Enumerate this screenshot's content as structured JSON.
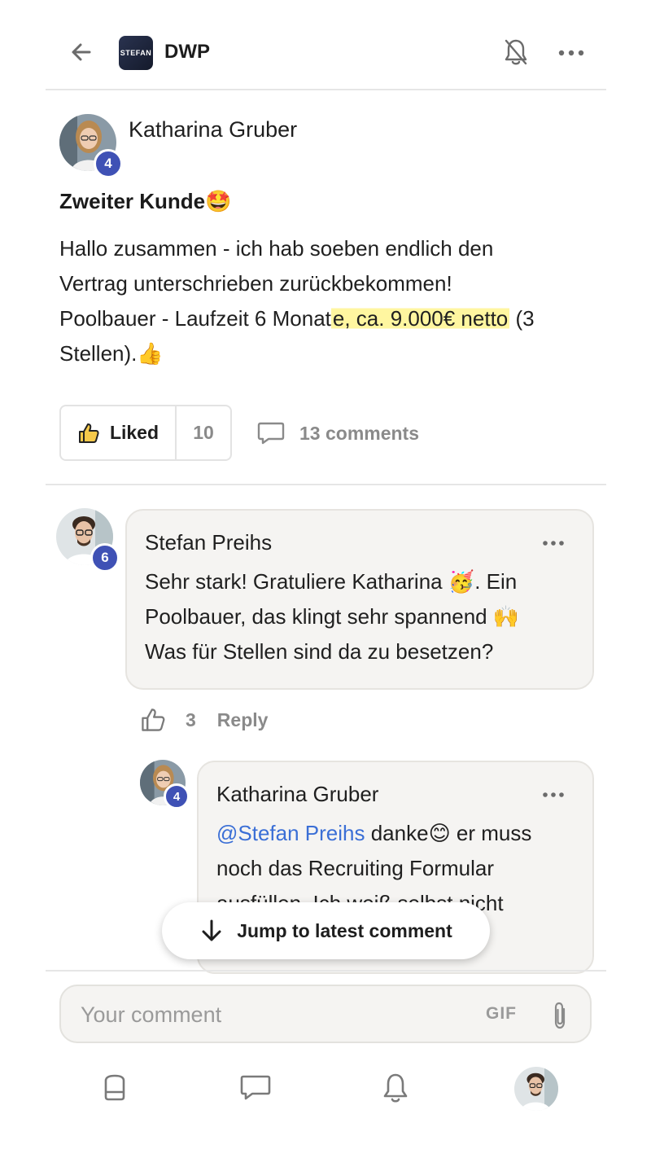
{
  "header": {
    "title": "DWP",
    "logo_text": "STEFAN"
  },
  "post": {
    "author": "Katharina Gruber",
    "author_badge": "4",
    "title": "Zweiter Kunde",
    "title_emoji": "🤩",
    "body_line1": "Hallo zusammen - ich hab soeben endlich den",
    "body_line2": "Vertrag unterschrieben zurückbekommen!",
    "body_line3_start": "Poolbauer - Laufzeit 6 Monat",
    "body_line3_highlight": "e, ca. 9.000€ netto",
    "body_line3_end": " (3",
    "body_line4": "Stellen).",
    "body_emoji": "👍",
    "liked_label": "Liked",
    "like_count": "10",
    "comments_label": "13 comments"
  },
  "comments": [
    {
      "author": "Stefan Preihs",
      "badge": "6",
      "line1": "Sehr stark! Gratuliere Katharina ",
      "emoji1": "🥳",
      "line1_end": ". Ein",
      "line2": "Poolbauer, das klingt sehr spannend ",
      "emoji2": "🙌",
      "line3": "Was für Stellen sind da zu besetzen?",
      "like_count": "3",
      "reply_label": "Reply"
    },
    {
      "author": "Katharina Gruber",
      "badge": "4",
      "mention": "@Stefan Preihs",
      "line1": " danke",
      "emoji1": "😊",
      "line1_end": " er muss",
      "line2": "noch das Recruiting Formular",
      "line3": "ausfüllen. Ich weiß selbst nicht"
    }
  ],
  "jump_button": "Jump to latest comment",
  "composer": {
    "placeholder": "Your comment",
    "gif_label": "GIF"
  },
  "colors": {
    "accent_badge": "#3f51b5",
    "mention": "#3b6fd6",
    "highlight": "#fff6a0"
  },
  "icons": [
    "back-arrow-icon",
    "bell-off-icon",
    "more-icon",
    "thumbs-up-icon",
    "comment-icon",
    "arrow-down-icon",
    "paperclip-icon",
    "home-icon",
    "chat-icon",
    "bell-icon"
  ]
}
